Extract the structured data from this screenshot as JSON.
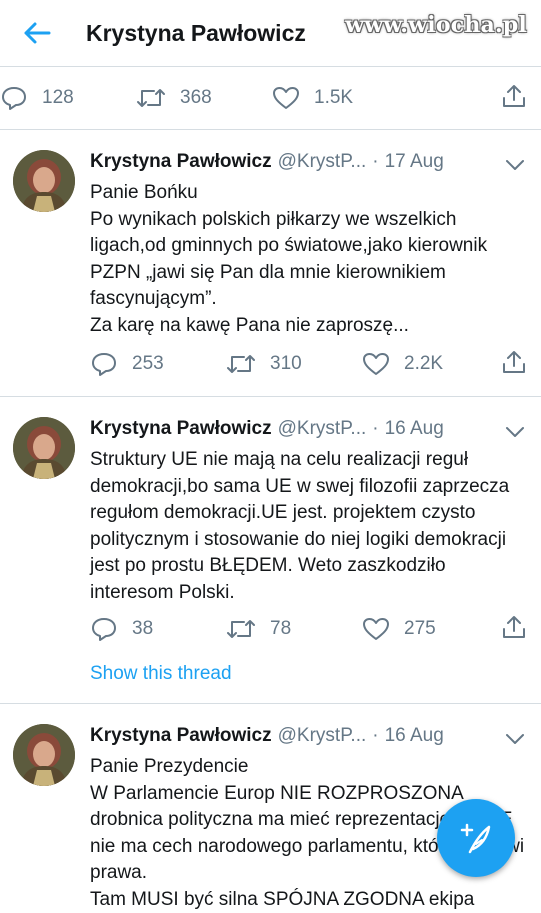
{
  "header": {
    "title": "Krystyna Pawłowicz",
    "watermark": "www.wiocha.pl"
  },
  "top_actions": {
    "replies": "128",
    "retweets": "368",
    "likes": "1.5K"
  },
  "tweets": [
    {
      "name": "Krystyna Pawłowicz",
      "handle": "@KrystP...",
      "date": "17 Aug",
      "text": "Panie Bońku\nPo wynikach polskich piłkarzy we wszelkich ligach,od gminnych po światowe,jako kierownik PZPN „jawi się Pan dla mnie kierownikiem fascynującym”.\nZa karę na kawę Pana nie zaproszę...",
      "replies": "253",
      "retweets": "310",
      "likes": "2.2K"
    },
    {
      "name": "Krystyna Pawłowicz",
      "handle": "@KrystP...",
      "date": "16 Aug",
      "text": "Struktury UE nie mają na celu realizacji reguł demokracji,bo sama UE w swej filozofii zaprzecza regułom demokracji.UE jest. projektem czysto politycznym i stosowanie do niej logiki demokracji jest po prostu BŁĘDEM. Weto zaszkodziło interesom Polski.",
      "replies": "38",
      "retweets": "78",
      "likes": "275",
      "thread_link": "Show this thread"
    },
    {
      "name": "Krystyna Pawłowicz",
      "handle": "@KrystP...",
      "date": "16 Aug",
      "text": "Panie Prezydencie\nW Parlamencie Europ NIE ROZPROSZONA drobnica polityczna ma mieć reprezentację, bo PE nie ma cech narodowego parlamentu, który stanowi prawa.\nTam MUSI być silna SPÓJNA ZGODNA ekipa"
    }
  ],
  "colors": {
    "accent": "#1da1f2",
    "secondary": "#657786",
    "divider": "#d6dde2"
  }
}
